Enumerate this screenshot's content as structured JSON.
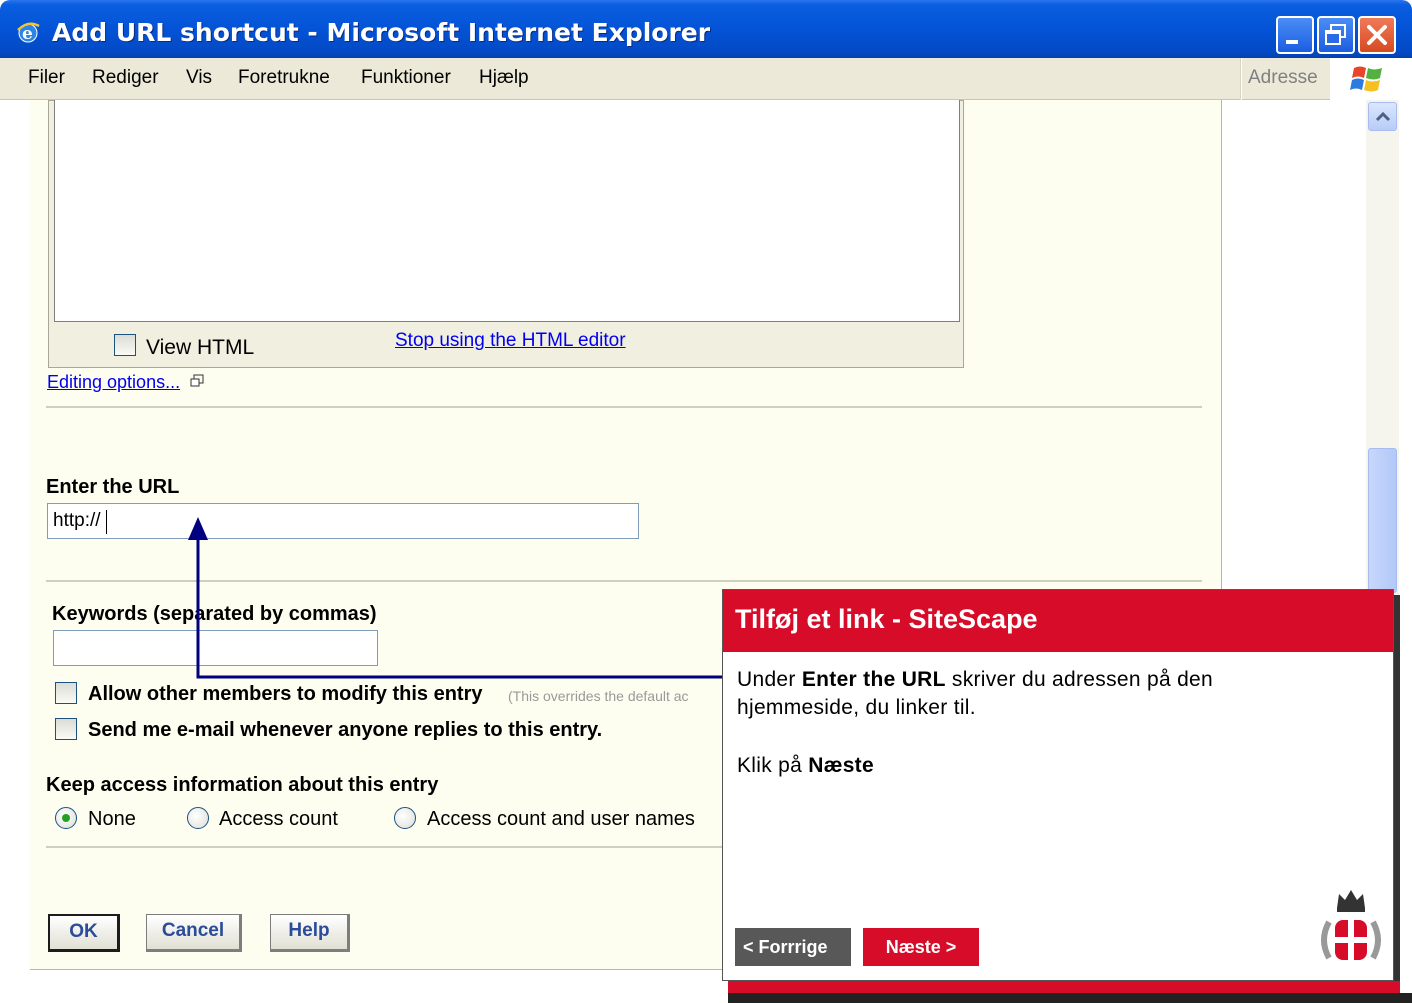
{
  "window": {
    "title": "Add URL shortcut - Microsoft Internet Explorer"
  },
  "menubar": {
    "items": [
      "Filer",
      "Rediger",
      "Vis",
      "Foretrukne",
      "Funktioner",
      "Hjælp"
    ],
    "address_label": "Adresse"
  },
  "editor": {
    "view_html_label": "View HTML",
    "stop_html_link": "Stop using the HTML editor",
    "editing_options_link": "Editing options..."
  },
  "url_section": {
    "label": "Enter the URL",
    "value": "http://"
  },
  "keywords": {
    "label": "Keywords (separated by commas)",
    "value": ""
  },
  "options": {
    "allow_modify_label": "Allow other members to modify this entry",
    "allow_modify_note": "(This overrides the default ac",
    "send_email_label": "Send me e-mail whenever anyone replies to this entry."
  },
  "access": {
    "label": "Keep access information about this entry",
    "options": [
      "None",
      "Access count",
      "Access count and user names"
    ],
    "selected": "None"
  },
  "buttons": {
    "ok": "OK",
    "cancel": "Cancel",
    "help": "Help"
  },
  "popup": {
    "title": "Tilføj et link - SiteScape",
    "line1_prefix": "Under ",
    "line1_bold": "Enter the URL",
    "line1_suffix": " skriver du adressen på den",
    "line2": "hjemmeside, du linker til.",
    "line3_prefix": "Klik på ",
    "line3_bold": "Næste",
    "prev_button": "< Forrrige",
    "next_button": "Næste >"
  },
  "colors": {
    "titlebar": "#0453d6",
    "popup_red": "#d70c29",
    "page_bg": "#fefef0",
    "arrow": "#000080"
  }
}
